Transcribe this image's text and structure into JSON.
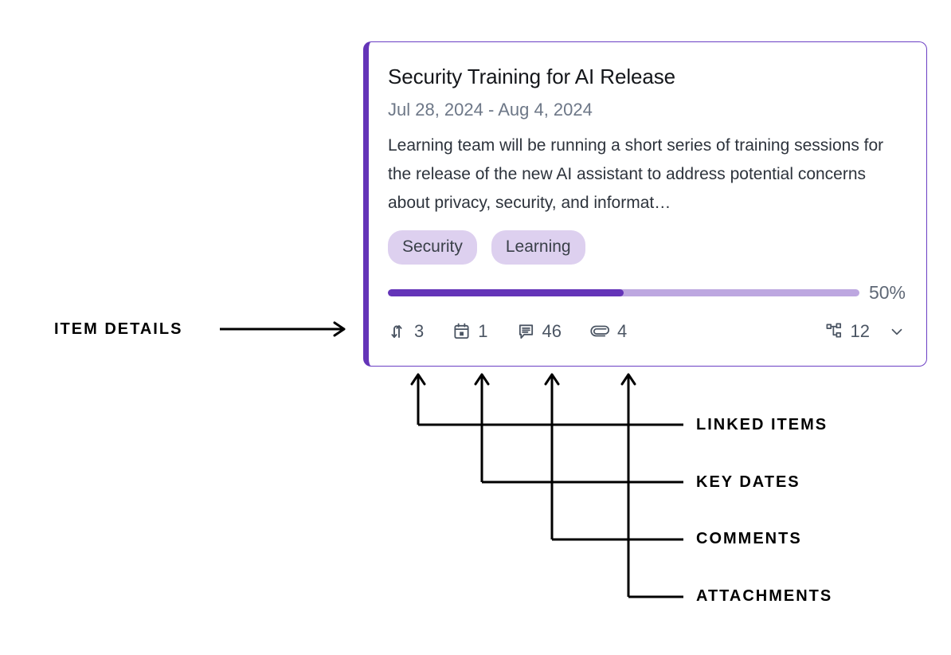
{
  "card": {
    "title": "Security Training for AI Release",
    "dates": "Jul 28, 2024 - Aug 4, 2024",
    "description": "Learning team will be running a short series of training sessions for the release of the new AI assistant to address potential concerns about privacy, security, and informat…",
    "tags": [
      "Security",
      "Learning"
    ],
    "progress": {
      "percent_label": "50%",
      "percent_value": 50,
      "fill_color": "#6434b8",
      "track_color": "#bda7e0"
    },
    "accent_color": "#6434b8",
    "border_color": "#6b3fc4",
    "meta": [
      {
        "icon": "linked-items-icon",
        "value": "3"
      },
      {
        "icon": "calendar-icon",
        "value": "1"
      },
      {
        "icon": "comment-icon",
        "value": "46"
      },
      {
        "icon": "paperclip-icon",
        "value": "4"
      }
    ],
    "subitems": {
      "icon": "hierarchy-icon",
      "value": "12",
      "chevron": "chevron-down-icon"
    }
  },
  "annotations": {
    "item_details": "ITEM DETAILS",
    "linked_items": "LINKED ITEMS",
    "key_dates": "KEY DATES",
    "comments": "COMMENTS",
    "attachments": "ATTACHMENTS"
  }
}
